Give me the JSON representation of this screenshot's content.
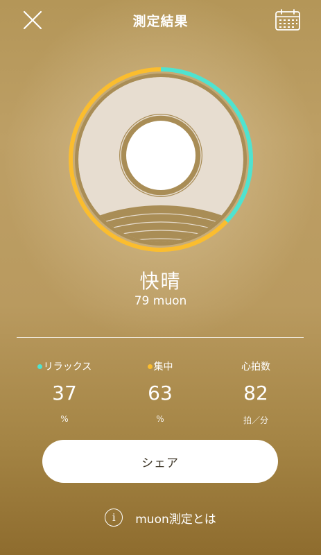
{
  "header": {
    "title": "測定結果",
    "close_icon": "close-icon",
    "calendar_icon": "calendar-icon"
  },
  "gauge": {
    "relax_color": "#4fe3d0",
    "focus_color": "#fbbd2e",
    "ring_bg": "#e7ddd0",
    "frame_color": "#a98d56",
    "relax_fraction": 0.37,
    "focus_fraction": 0.63
  },
  "result": {
    "state": "快晴",
    "score": "79 muon"
  },
  "stats": {
    "relax": {
      "label": "リラックス",
      "value": "37",
      "unit": "%",
      "dot_color": "#4fe3d0"
    },
    "focus": {
      "label": "集中",
      "value": "63",
      "unit": "%",
      "dot_color": "#fbbd2e"
    },
    "heart": {
      "label": "心拍数",
      "value": "82",
      "unit": "拍／分"
    }
  },
  "share_button": {
    "label": "シェア"
  },
  "about_link": {
    "label": "muon測定とは",
    "icon": "info-icon"
  }
}
